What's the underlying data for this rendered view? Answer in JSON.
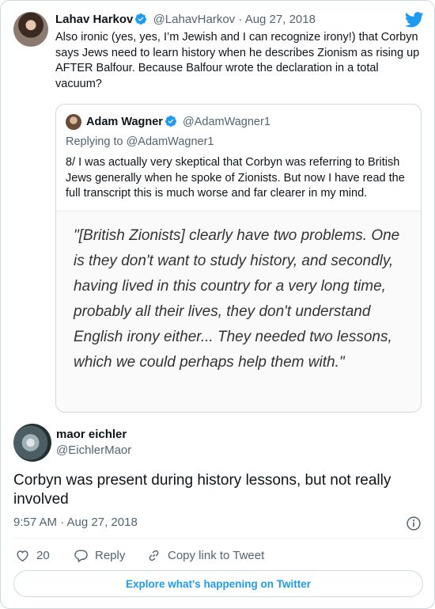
{
  "parent_tweet": {
    "author_name": "Lahav Harkov",
    "handle": "@LahavHarkov",
    "separator": "·",
    "date": "Aug 27, 2018",
    "text": "Also ironic (yes, yes, I’m Jewish and I can recognize irony!) that Corbyn says Jews need to learn history when he describes Zionism as rising up AFTER Balfour. Because Balfour wrote the declaration in a total vacuum?"
  },
  "quoted_tweet": {
    "author_name": "Adam Wagner",
    "handle": "@AdamWagner1",
    "replying_to": "Replying to @AdamWagner1",
    "text": "8/ I was actually very skeptical that Corbyn was referring to British Jews generally when he spoke of Zionists. But now I have read the full transcript this is much worse and far clearer in my mind.",
    "image_quote": "\"[British Zionists] clearly have two problems. One is they don't want to study history, and secondly, having lived in this country for a very long time, probably all their lives, they don't understand English irony either... They needed two lessons, which we could perhaps help them with.\""
  },
  "reply_tweet": {
    "author_name": "maor eichler",
    "handle": "@EichlerMaor",
    "text": "Corbyn was present during history lessons, but not really involved",
    "timestamp": "9:57 AM · Aug 27, 2018"
  },
  "actions": {
    "like_count": "20",
    "reply_label": "Reply",
    "copy_link_label": "Copy link to Tweet"
  },
  "explore_label": "Explore what's happening on Twitter",
  "icons": {
    "twitter_logo": "twitter-bird-icon",
    "verified": "verified-badge-icon",
    "info": "info-icon",
    "like": "heart-icon",
    "reply": "reply-bubble-icon",
    "copy_link": "link-icon"
  },
  "colors": {
    "accent": "#1d9bf0",
    "text": "#0f1419",
    "muted": "#536471",
    "border": "#cfd9de"
  }
}
